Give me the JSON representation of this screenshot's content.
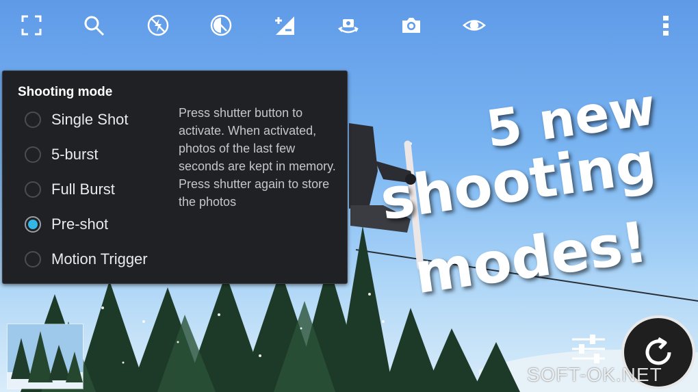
{
  "toolbar": {
    "icons": [
      "focus-frame-icon",
      "search-icon",
      "flash-off-icon",
      "exposure-lock-icon",
      "exposure-compensation-icon",
      "switch-camera-icon",
      "camera-icon",
      "eye-icon",
      "more-vert-icon"
    ]
  },
  "shooting_mode": {
    "title": "Shooting mode",
    "options": [
      {
        "label": "Single Shot",
        "selected": false
      },
      {
        "label": "5-burst",
        "selected": false
      },
      {
        "label": "Full Burst",
        "selected": false
      },
      {
        "label": "Pre-shot",
        "selected": true
      },
      {
        "label": "Motion Trigger",
        "selected": false
      }
    ],
    "description": "Press shutter button to activate. When activated, photos of the last few seconds are kept in memory. Press shutter again to store the photos"
  },
  "promo": {
    "line1": "5 new",
    "line2": "shooting",
    "line3": "modes!"
  },
  "watermark": "SOFT-OK.NET",
  "colors": {
    "accent": "#33b5e5",
    "panel": "#202124"
  }
}
